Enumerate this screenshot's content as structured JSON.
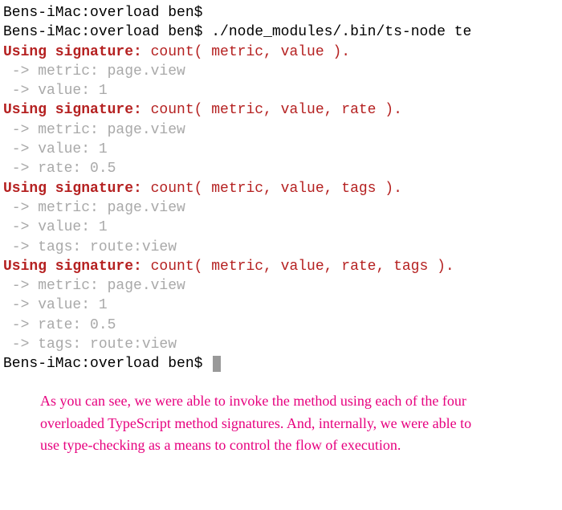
{
  "prompts": {
    "host_path": "Bens-iMac:overload ben$",
    "blank_cmd": " ",
    "run_cmd": " ./node_modules/.bin/ts-node te"
  },
  "sig_label": "Using signature:",
  "blocks": [
    {
      "sig_text": " count( metric, value ).",
      "lines": [
        " -> metric: page.view",
        " -> value: 1"
      ]
    },
    {
      "sig_text": " count( metric, value, rate ).",
      "lines": [
        " -> metric: page.view",
        " -> value: 1",
        " -> rate: 0.5"
      ]
    },
    {
      "sig_text": " count( metric, value, tags ).",
      "lines": [
        " -> metric: page.view",
        " -> value: 1",
        " -> tags: route:view"
      ]
    },
    {
      "sig_text": " count( metric, value, rate, tags ).",
      "lines": [
        " -> metric: page.view",
        " -> value: 1",
        " -> rate: 0.5",
        " -> tags: route:view"
      ]
    }
  ],
  "caption": {
    "part1": "As you can see, we were able to invoke the method using each of the four ",
    "highlight": "overloaded TypeScript method signatures",
    "part2": ". And, internally, we were able to use type-checking as a means to control the flow of execution."
  }
}
